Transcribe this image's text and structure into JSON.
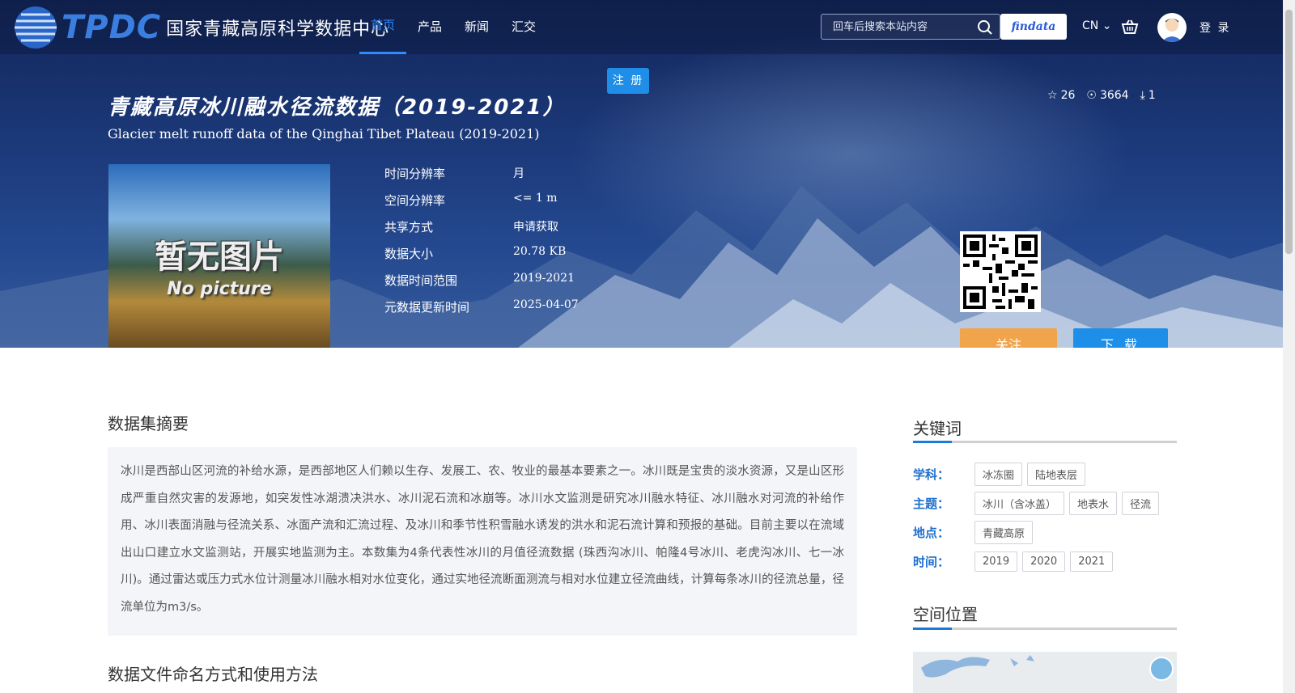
{
  "header": {
    "logo_text": "TPDC",
    "site_name": "国家青藏高原科学数据中心",
    "nav": [
      "首页",
      "产品",
      "新闻",
      "汇交"
    ],
    "search_placeholder": "回车后搜索本站内容",
    "findata": "findata",
    "lang": "CN",
    "login": "登 录",
    "register": "注 册"
  },
  "dataset": {
    "title": "青藏高原冰川融水径流数据（2019-2021）",
    "title_en": "Glacier melt runoff data of the Qinghai Tibet Plateau (2019-2021)",
    "stars": "26",
    "views": "3664",
    "downloads": "1",
    "thumb_text": "暂无图片",
    "thumb_text_en": "No picture",
    "meta": [
      [
        "时间分辨率",
        "月"
      ],
      [
        "空间分辨率",
        "<= 1 m"
      ],
      [
        "共享方式",
        "申请获取"
      ],
      [
        "数据大小",
        "20.78 KB"
      ],
      [
        "数据时间范围",
        "2019-2021"
      ],
      [
        "元数据更新时间",
        "2025-04-07"
      ]
    ],
    "follow": "关注",
    "download": "下 载"
  },
  "abstract": {
    "title": "数据集摘要",
    "text": "冰川是西部山区河流的补给水源，是西部地区人们赖以生存、发展工、农、牧业的最基本要素之一。冰川既是宝贵的淡水资源，又是山区形成严重自然灾害的发源地，如突发性冰湖溃决洪水、冰川泥石流和冰崩等。冰川水文监测是研究冰川融水特征、冰川融水对河流的补给作用、冰川表面消融与径流关系、冰面产流和汇流过程、及冰川和季节性积雪融水诱发的洪水和泥石流计算和预报的基础。目前主要以在流域出山口建立水文监测站，开展实地监测为主。本数集为4条代表性冰川的月值径流数据 (珠西沟冰川、帕隆4号冰川、老虎沟冰川、七一冰川)。通过雷达或压力式水位计测量冰川融水相对水位变化，通过实地径流断面测流与相对水位建立径流曲线，计算每条冰川的径流总量，径流单位为m3/s。"
  },
  "naming": {
    "title": "数据文件命名方式和使用方法"
  },
  "keywords": {
    "title": "关键词",
    "groups": [
      {
        "label": "学科：",
        "tags": [
          "冰冻圈",
          "陆地表层"
        ]
      },
      {
        "label": "主题：",
        "tags": [
          "冰川（含冰盖）",
          "地表水",
          "径流"
        ]
      },
      {
        "label": "地点：",
        "tags": [
          "青藏高原"
        ]
      },
      {
        "label": "时间：",
        "tags": [
          "2019",
          "2020",
          "2021"
        ]
      }
    ]
  },
  "spatial": {
    "title": "空间位置"
  }
}
